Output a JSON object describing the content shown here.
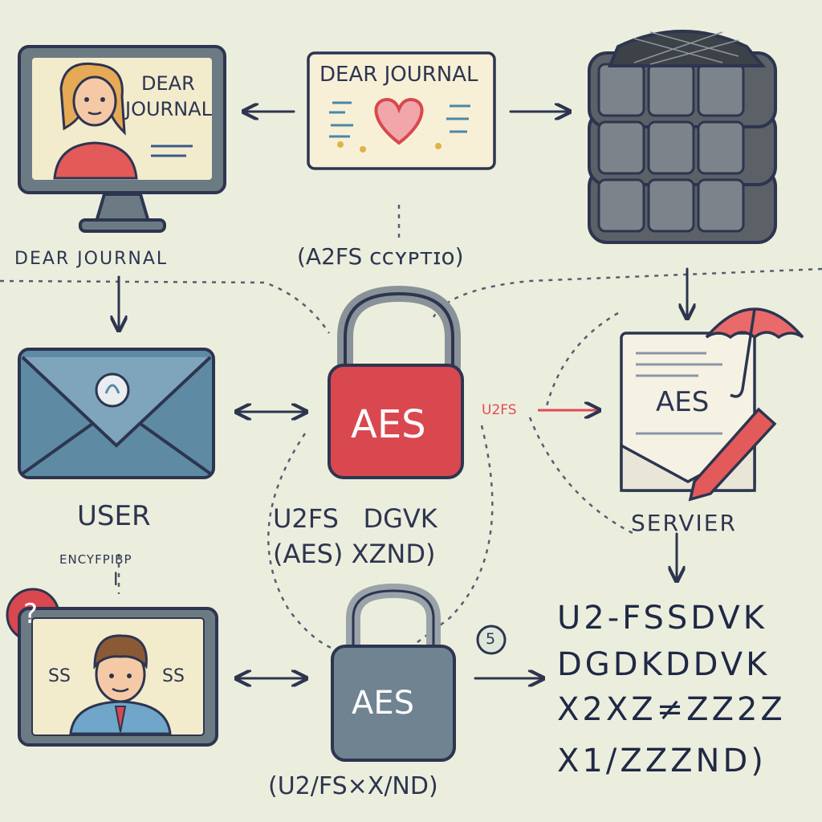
{
  "colors": {
    "background": "#eceedd",
    "ink": "#2d3550",
    "lock_red": "#d9484f",
    "lock_gray": "#6f8391",
    "envelope_blue": "#5e8aa3",
    "server_gray": "#5c6168",
    "accent_red": "#e14a57"
  },
  "top": {
    "monitor_text": [
      "DEAR",
      "JOURNAL"
    ],
    "note_title": "DEAR JOURNAL",
    "caption_left": "DEAR JOURNAL",
    "caption_center": "(A2FS ᴄᴄʏᴘᴛɪᴏ)"
  },
  "middle": {
    "user_label": "USER",
    "lock_label": "AES",
    "arrow_tag": "U2FS",
    "server_doc_label": "AES",
    "server_label": "SERVIER",
    "cipher_caption_line1": "U2FS   DGVK",
    "cipher_caption_line2": "(AES) XZND)"
  },
  "bottom": {
    "encrypt_label": "ENCYFPIBP",
    "encrypt_mark": "I",
    "badge_question": "?",
    "monitor_left": "SS",
    "monitor_right": "SS",
    "lock_label": "AES",
    "step_badge": "5",
    "lock_caption": "(U2/FS×X/ND)",
    "ciphertext": [
      "U2-FSSDVK",
      "DGDKDDVK",
      "X2XZ≠ZZ2Z",
      "X1/ZZZND)"
    ]
  }
}
